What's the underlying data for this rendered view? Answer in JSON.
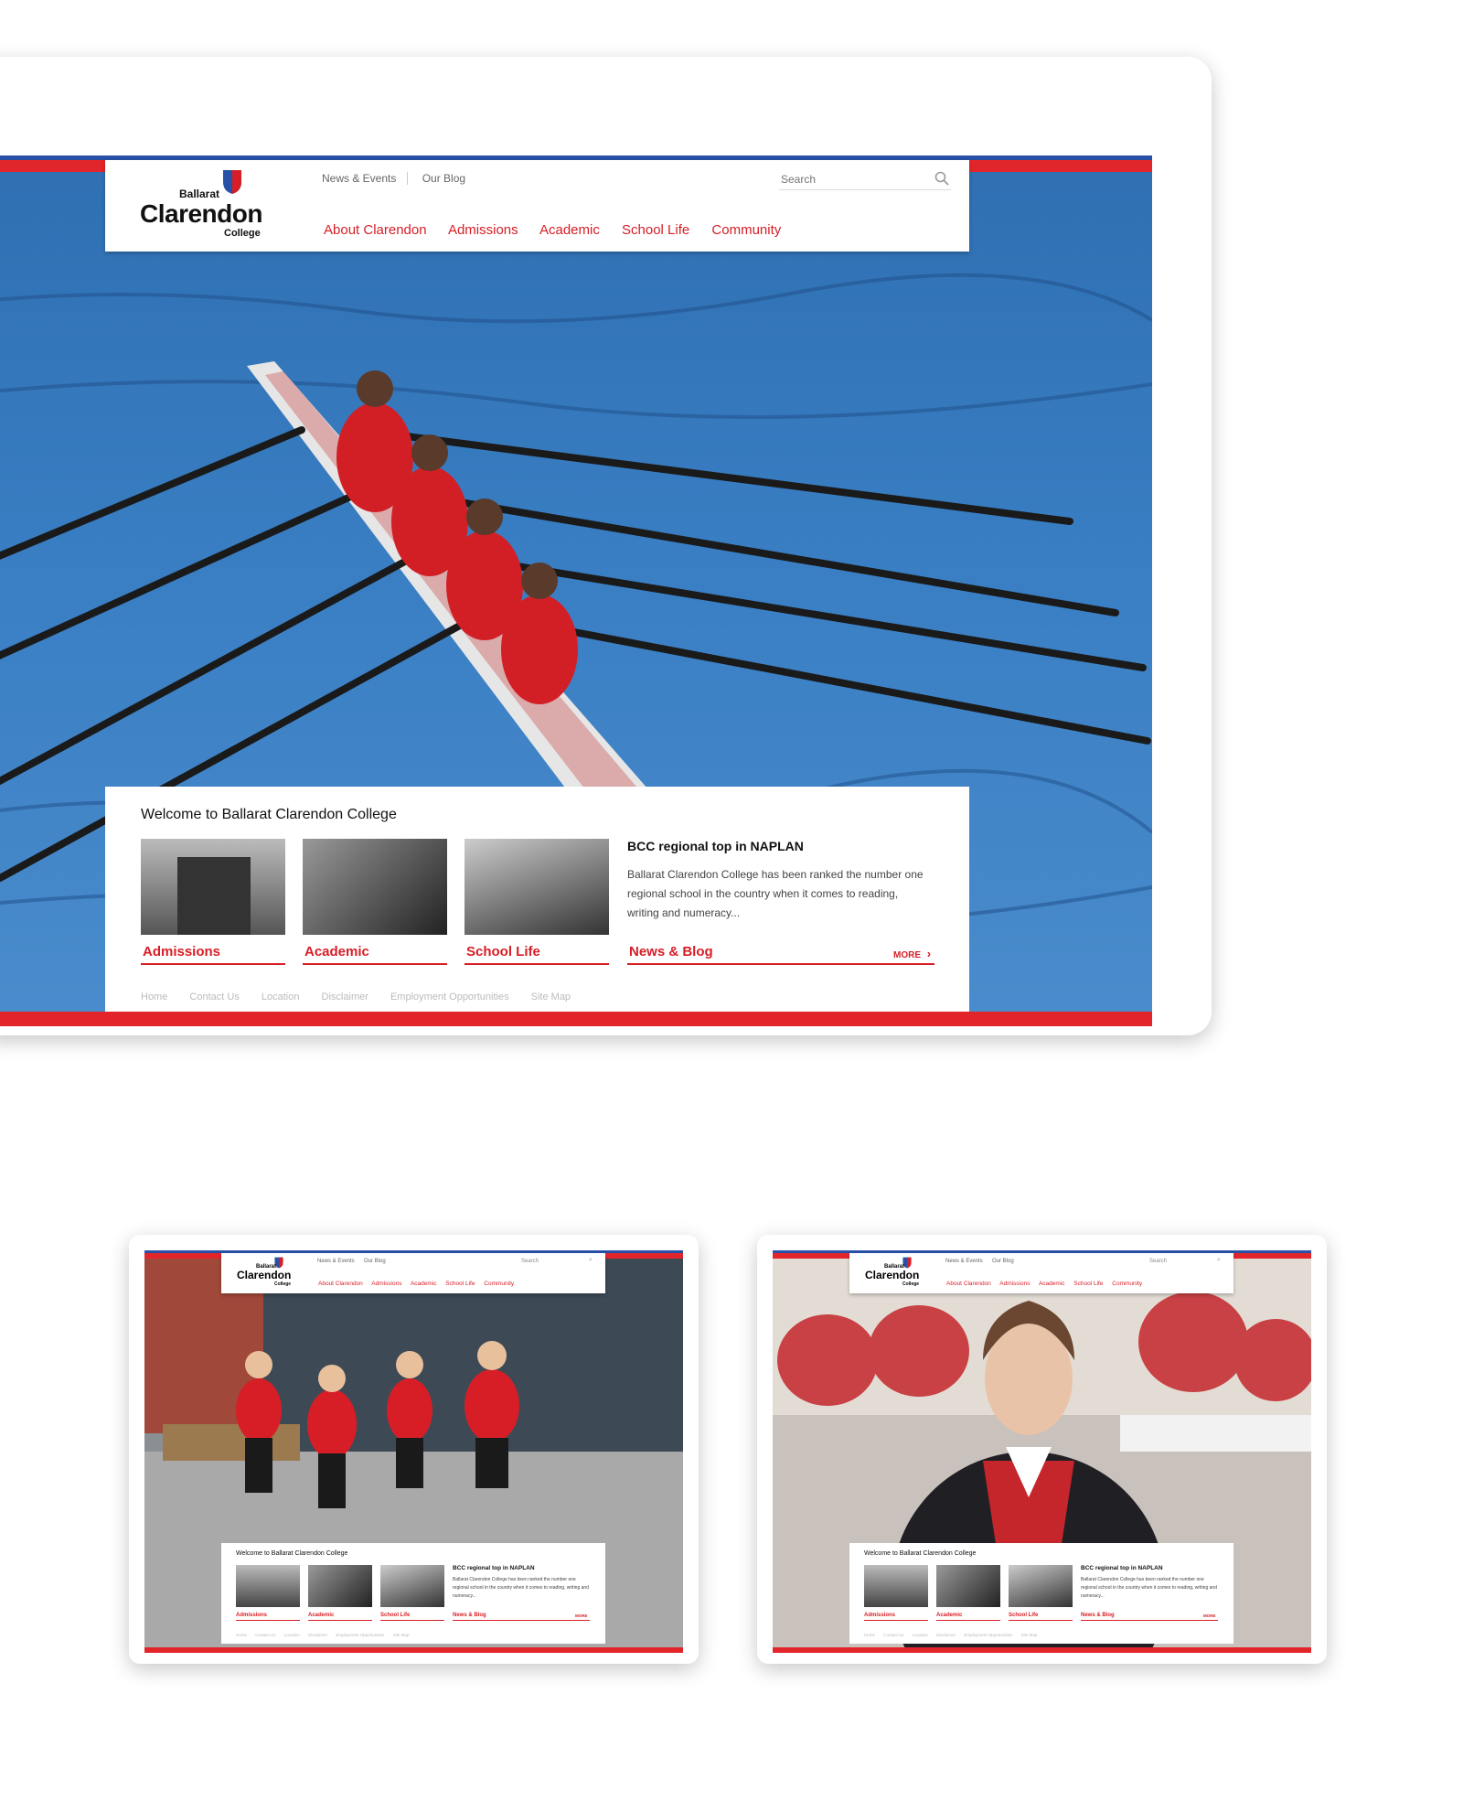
{
  "logo": {
    "line1": "Ballarat",
    "line2": "Clarendon",
    "line3": "College"
  },
  "utility_nav": [
    "News & Events",
    "Our Blog"
  ],
  "search": {
    "placeholder": "Search"
  },
  "main_nav": [
    "About Clarendon",
    "Admissions",
    "Academic",
    "School Life",
    "Community"
  ],
  "welcome": {
    "heading": "Welcome to Ballarat Clarendon College",
    "tiles": [
      "Admissions",
      "Academic",
      "School Life"
    ],
    "news": {
      "title": "BCC regional top in NAPLAN",
      "body": "Ballarat Clarendon College has been ranked the number one regional school in the country when it comes to reading, writing and numeracy...",
      "label": "News & Blog",
      "more": "MORE"
    }
  },
  "footer_links": [
    "Home",
    "Contact Us",
    "Location",
    "Disclaimer",
    "Employment Opportunities",
    "Site Map"
  ],
  "colors": {
    "brand_red": "#d71e26",
    "brand_blue": "#2750a6",
    "bar_red": "#e2252b"
  }
}
